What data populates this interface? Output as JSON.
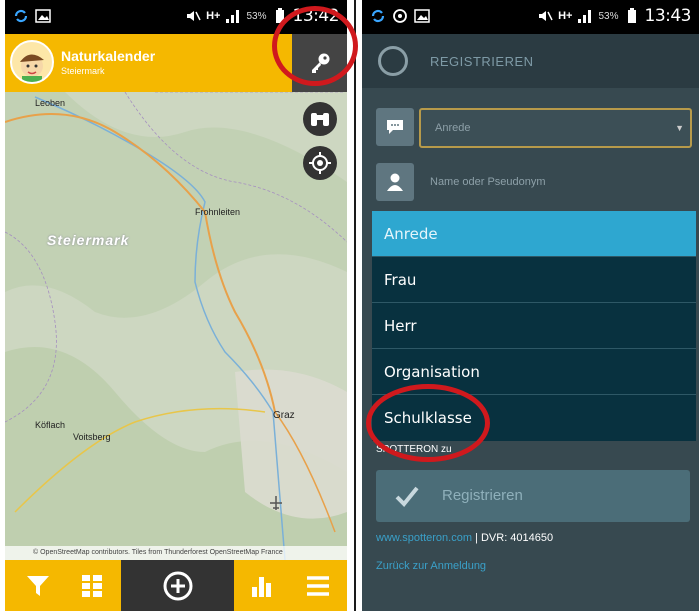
{
  "left_screen": {
    "status": {
      "battery": "53%",
      "time": "13:42",
      "network": "H+"
    },
    "app_title": "Naturkalender",
    "app_subtitle": "Steiermark",
    "map_labels": {
      "leoben": "Leoben",
      "frohnleiten": "Frohnleiten",
      "region": "Steiermark",
      "graz": "Graz",
      "koflach": "Köflach",
      "voitsberg": "Voitsberg"
    },
    "attribution": "© OpenStreetMap contributors. Tiles from Thunderforest OpenStreetMap France",
    "icons": {
      "key": "key-icon",
      "binoculars": "binoculars-icon",
      "locate": "locate-icon",
      "filter": "filter-icon",
      "list": "list-icon",
      "add": "add-icon",
      "stats": "bar-chart-icon",
      "menu": "menu-icon"
    }
  },
  "right_screen": {
    "status": {
      "battery": "53%",
      "time": "13:43",
      "network": "H+"
    },
    "header_title": "REGISTRIEREN",
    "select_value": "Anrede",
    "name_placeholder": "Name oder Pseudonym",
    "dropdown": {
      "header": "Anrede",
      "options": [
        "Frau",
        "Herr",
        "Organisation",
        "Schulklasse"
      ]
    },
    "partial_text": "SPOTTERON zu",
    "register_label": "Registrieren",
    "footer_link": "www.spotteron.com",
    "footer_sep": " | ",
    "footer_dvr": "DVR: 4014650",
    "back_link": "Zurück zur Anmeldung"
  },
  "colors": {
    "app_yellow": "#f5b800",
    "highlight_red": "#d0191d",
    "dropdown_header": "#2ea7d0",
    "dropdown_bg": "#08313f"
  }
}
